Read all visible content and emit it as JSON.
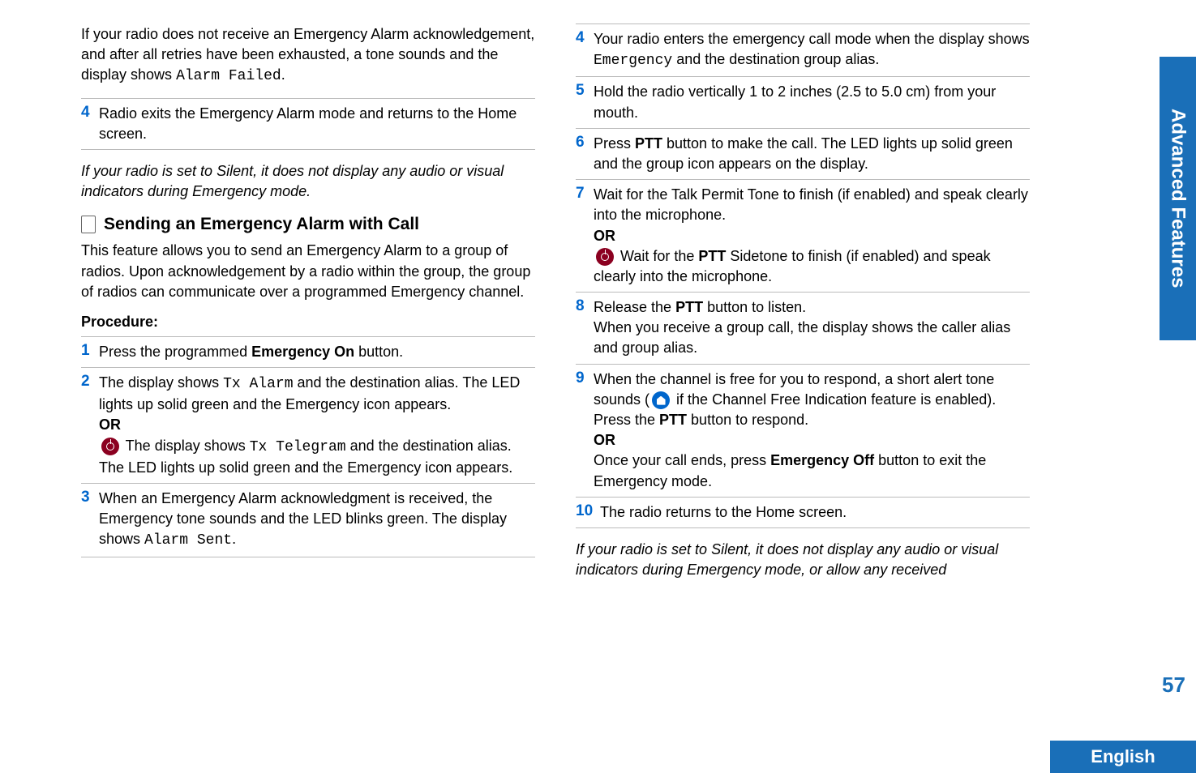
{
  "tab": "Advanced Features",
  "pagenum": "57",
  "lang": "English",
  "left": {
    "intro": "If your radio does not receive an Emergency Alarm acknowledgement, and after all retries have been exhausted, a tone sounds and the display shows ",
    "intro_mono": "Alarm Failed",
    "intro_end": ".",
    "step4_num": "4",
    "step4": "Radio exits the Emergency Alarm mode and returns to the Home screen.",
    "italic": "If your radio is set to Silent, it does not display any audio or visual indicators during Emergency mode.",
    "heading": "Sending an Emergency Alarm with Call",
    "headdesc": "This feature allows you to send an Emergency Alarm to a group of radios. Upon acknowledgement by a radio within the group, the group of radios can communicate over a programmed Emergency channel.",
    "procedure": "Procedure:",
    "s1_num": "1",
    "s1a": "Press the programmed ",
    "s1b": "Emergency On",
    "s1c": " button.",
    "s2_num": "2",
    "s2a": "The display shows ",
    "s2mono1": "Tx Alarm",
    "s2b": " and the destination alias. The LED lights up solid green and the Emergency icon appears.",
    "or1": "OR",
    "s2c": " The display shows ",
    "s2mono2": "Tx Telegram",
    "s2d": " and the destination alias. The LED lights up solid green and the Emergency icon appears.",
    "s3_num": "3",
    "s3a": "When an Emergency Alarm acknowledgment is received, the Emergency tone sounds and the LED blinks green. The display shows ",
    "s3mono": "Alarm Sent",
    "s3b": "."
  },
  "right": {
    "s4_num": "4",
    "s4a": "Your radio enters the emergency call mode when the display shows ",
    "s4mono": "Emergency",
    "s4b": " and the destination group alias.",
    "s5_num": "5",
    "s5": "Hold the radio vertically 1 to 2 inches (2.5 to 5.0 cm) from your mouth.",
    "s6_num": "6",
    "s6a": "Press ",
    "s6b": "PTT",
    "s6c": " button to make the call. The LED lights up solid green and the group icon appears on the display.",
    "s7_num": "7",
    "s7a": "Wait for the Talk Permit Tone to finish (if enabled) and speak clearly into the microphone.",
    "or2": "OR",
    "s7b": " Wait for the ",
    "s7c": "PTT",
    "s7d": " Sidetone to finish (if enabled) and speak clearly into the microphone.",
    "s8_num": "8",
    "s8a": "Release the ",
    "s8b": "PTT",
    "s8c": " button to listen.",
    "s8d": "When you receive a group call, the display shows the caller alias and group alias.",
    "s9_num": "9",
    "s9a": "When the channel is free for you to respond, a short alert tone sounds (",
    "s9b": " if the Channel Free Indication feature is enabled). Press the ",
    "s9c": "PTT",
    "s9d": " button to respond.",
    "or3": "OR",
    "s9e": "Once your call ends, press ",
    "s9f": "Emergency Off",
    "s9g": " button to exit the Emergency mode.",
    "s10_num": "10",
    "s10": "The radio returns to the Home screen.",
    "italic": "If your radio is set to Silent, it does not display any audio or visual indicators during Emergency mode, or allow any received"
  }
}
